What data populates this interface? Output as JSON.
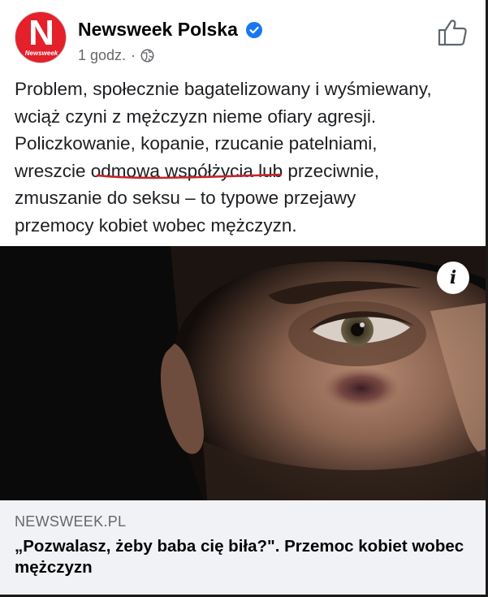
{
  "post": {
    "page_name": "Newsweek Polska",
    "avatar_logo_letter": "N",
    "avatar_logo_word": "Newsweek",
    "time": "1 godz.",
    "separator": "·",
    "text_lines": [
      "Problem, społecznie bagatelizowany i wyśmiewany,",
      "wciąż czyni z mężczyzn nieme ofiary agresji.",
      "Policzkowanie, kopanie, rzucanie patelniami,"
    ],
    "line4_before": "wreszcie ",
    "line4_highlight": "odmowa współżycia",
    "line4_after": " lub przeciwnie,",
    "text_lines_end": [
      "zmuszanie do seksu – to typowe przejawy",
      "przemocy kobiet wobec mężczyzn."
    ],
    "underline_color": "#c8242a"
  },
  "media": {
    "info_label": "i"
  },
  "link_preview": {
    "domain": "NEWSWEEK.PL",
    "title": "„Pozwalasz, żeby baba cię biła?\". Przemoc kobiet wobec mężczyzn"
  },
  "icons": {
    "verified": "verified-badge-icon",
    "audience": "globe-icon",
    "like": "thumbs-up-icon",
    "info": "info-icon"
  },
  "colors": {
    "brand_red": "#e4202b",
    "verified_blue": "#1877f2",
    "secondary_text": "#65676b",
    "link_bg": "#f0f2f5"
  }
}
